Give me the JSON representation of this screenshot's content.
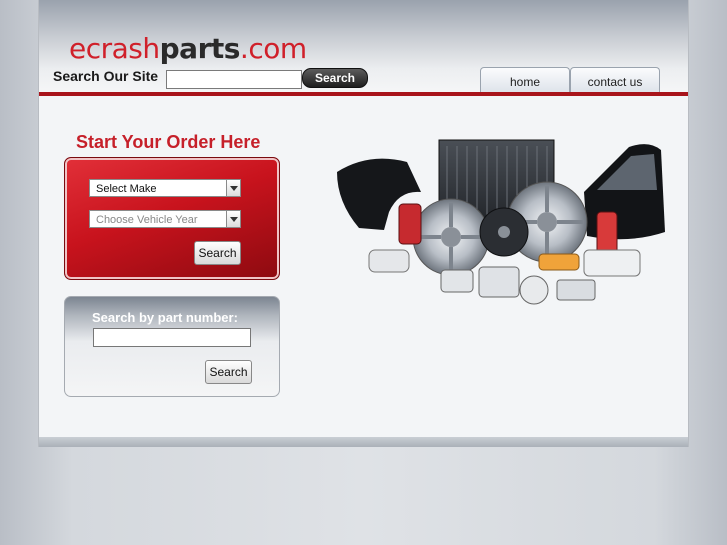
{
  "header": {
    "logo": {
      "part1": "ecrash",
      "part2": "parts",
      "part3": ".com"
    },
    "search_label": "Search Our Site",
    "search_value": "",
    "search_button": "Search"
  },
  "nav": {
    "tabs": [
      {
        "label": "home"
      },
      {
        "label": "contact us"
      }
    ]
  },
  "order": {
    "title": "Start Your Order Here",
    "make_select": "Select Make",
    "year_select": "Choose Vehicle Year",
    "search_button": "Search"
  },
  "part_search": {
    "label": "Search by part number:",
    "value": "",
    "search_button": "Search"
  },
  "colors": {
    "brand_red": "#c6202a",
    "rule_red": "#a8141b"
  },
  "icons": [
    "dropdown-arrow-icon"
  ]
}
